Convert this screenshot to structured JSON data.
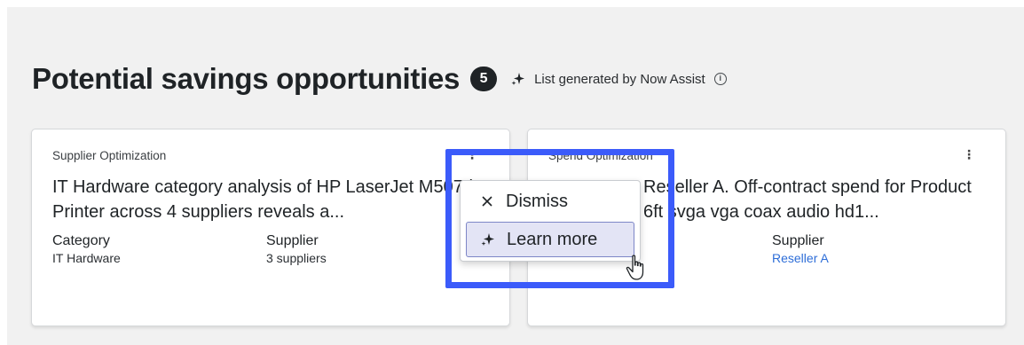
{
  "header": {
    "title": "Potential savings opportunities",
    "count": "5",
    "generated_label": "List generated by Now Assist",
    "sparkle_icon": "sparkle-icon",
    "info_icon": "info-icon"
  },
  "cards": [
    {
      "type": "Supplier Optimization",
      "description": "IT Hardware category analysis of HP LaserJet M507dn Printer across 4 suppliers reveals a...",
      "fields": [
        {
          "label": "Category",
          "value": "IT Hardware"
        },
        {
          "label": "Supplier",
          "value": "3 suppliers"
        }
      ]
    },
    {
      "type": "Spend Optimization",
      "description": "Reseller A. Off-contract spend for Product 6ft svga vga coax audio hd1...",
      "fields": [
        {
          "label": "Supplier",
          "value": "Reseller A"
        }
      ]
    }
  ],
  "menu": {
    "items": [
      {
        "label": "Dismiss",
        "icon": "close-icon"
      },
      {
        "label": "Learn more",
        "icon": "sparkle-icon"
      }
    ]
  },
  "colors": {
    "highlight": "#3b5bfa",
    "link": "#2e6ed8",
    "menu_selected_bg": "#e3e4f5"
  }
}
